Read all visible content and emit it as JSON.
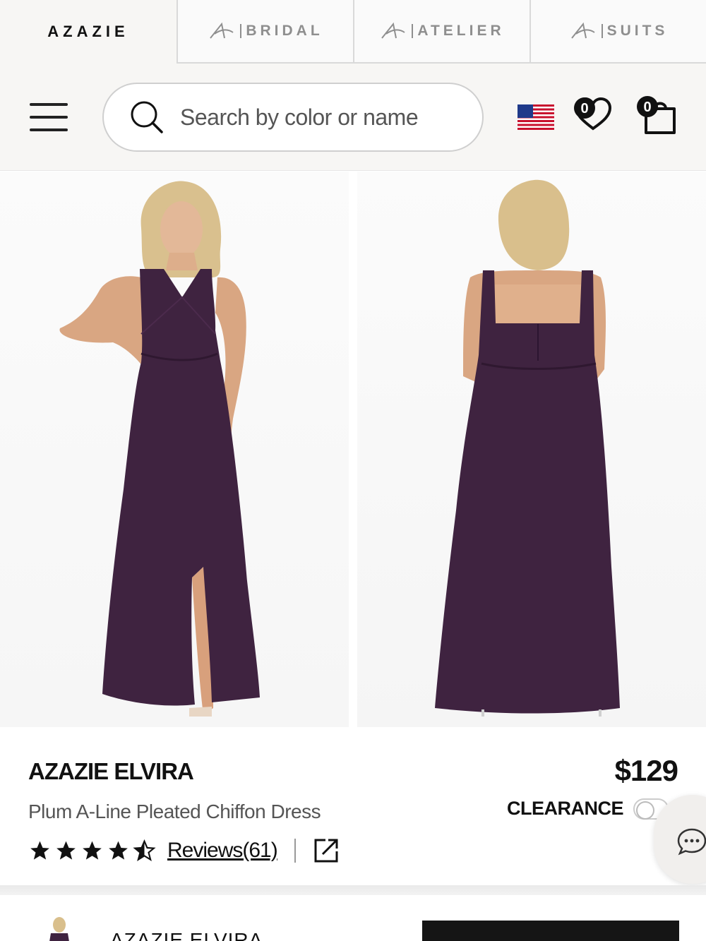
{
  "brand_tabs": [
    {
      "label": "AZAZIE",
      "active": true
    },
    {
      "label": "BRIDAL",
      "active": false
    },
    {
      "label": "ATELIER",
      "active": false
    },
    {
      "label": "SUITS",
      "active": false
    }
  ],
  "header": {
    "menu_icon": "hamburger-menu-icon",
    "search_placeholder": "Search by color or name",
    "search_icon": "search-icon",
    "region": "us-flag-icon",
    "wishlist_count": "0",
    "cart_count": "0"
  },
  "product": {
    "name": "AZAZIE ELVIRA",
    "description": "Plum A-Line Pleated Chiffon Dress",
    "price": "$129",
    "rating": 4.5,
    "reviews_label": "Reviews(61)",
    "clearance_label": "CLEARANCE",
    "clearance_on": false,
    "dress_color": "#3f2340"
  },
  "sticky_bar": {
    "name": "AZAZIE ELVIRA"
  },
  "colors": {
    "accent": "#111111",
    "muted": "#8f8f8f",
    "plum": "#3f2340"
  }
}
